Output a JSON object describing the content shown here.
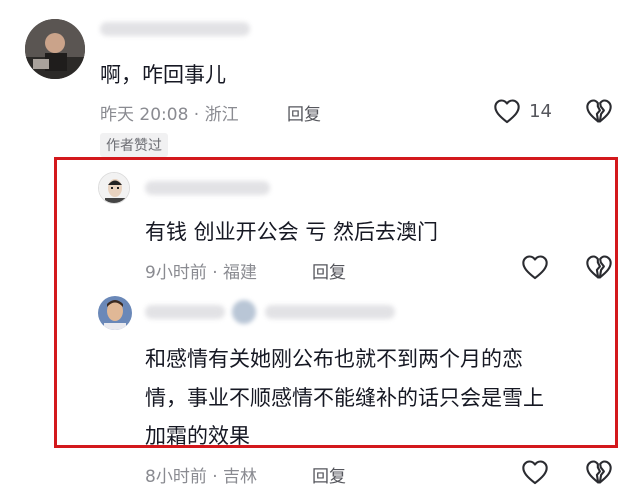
{
  "comments": [
    {
      "text": "啊，咋回事儿",
      "meta": "昨天 20:08 · 浙江",
      "reply_label": "回复",
      "like_count": "14",
      "badge": "作者赞过"
    },
    {
      "text": "有钱 创业开公会 亏 然后去澳门",
      "meta": "9小时前 · 福建",
      "reply_label": "回复"
    },
    {
      "text_line1": "和感情有关她刚公布也就不到两个月的恋",
      "text_line2": "情，事业不顺感情不能缝补的话只会是雪上",
      "text_line3": "加霜的效果",
      "meta": "8小时前 · 吉林",
      "reply_label": "回复"
    }
  ],
  "colors": {
    "highlight": "#d3181c",
    "meta": "#8a8b91"
  },
  "icons": [
    "heart-outline-icon",
    "broken-heart-icon"
  ]
}
